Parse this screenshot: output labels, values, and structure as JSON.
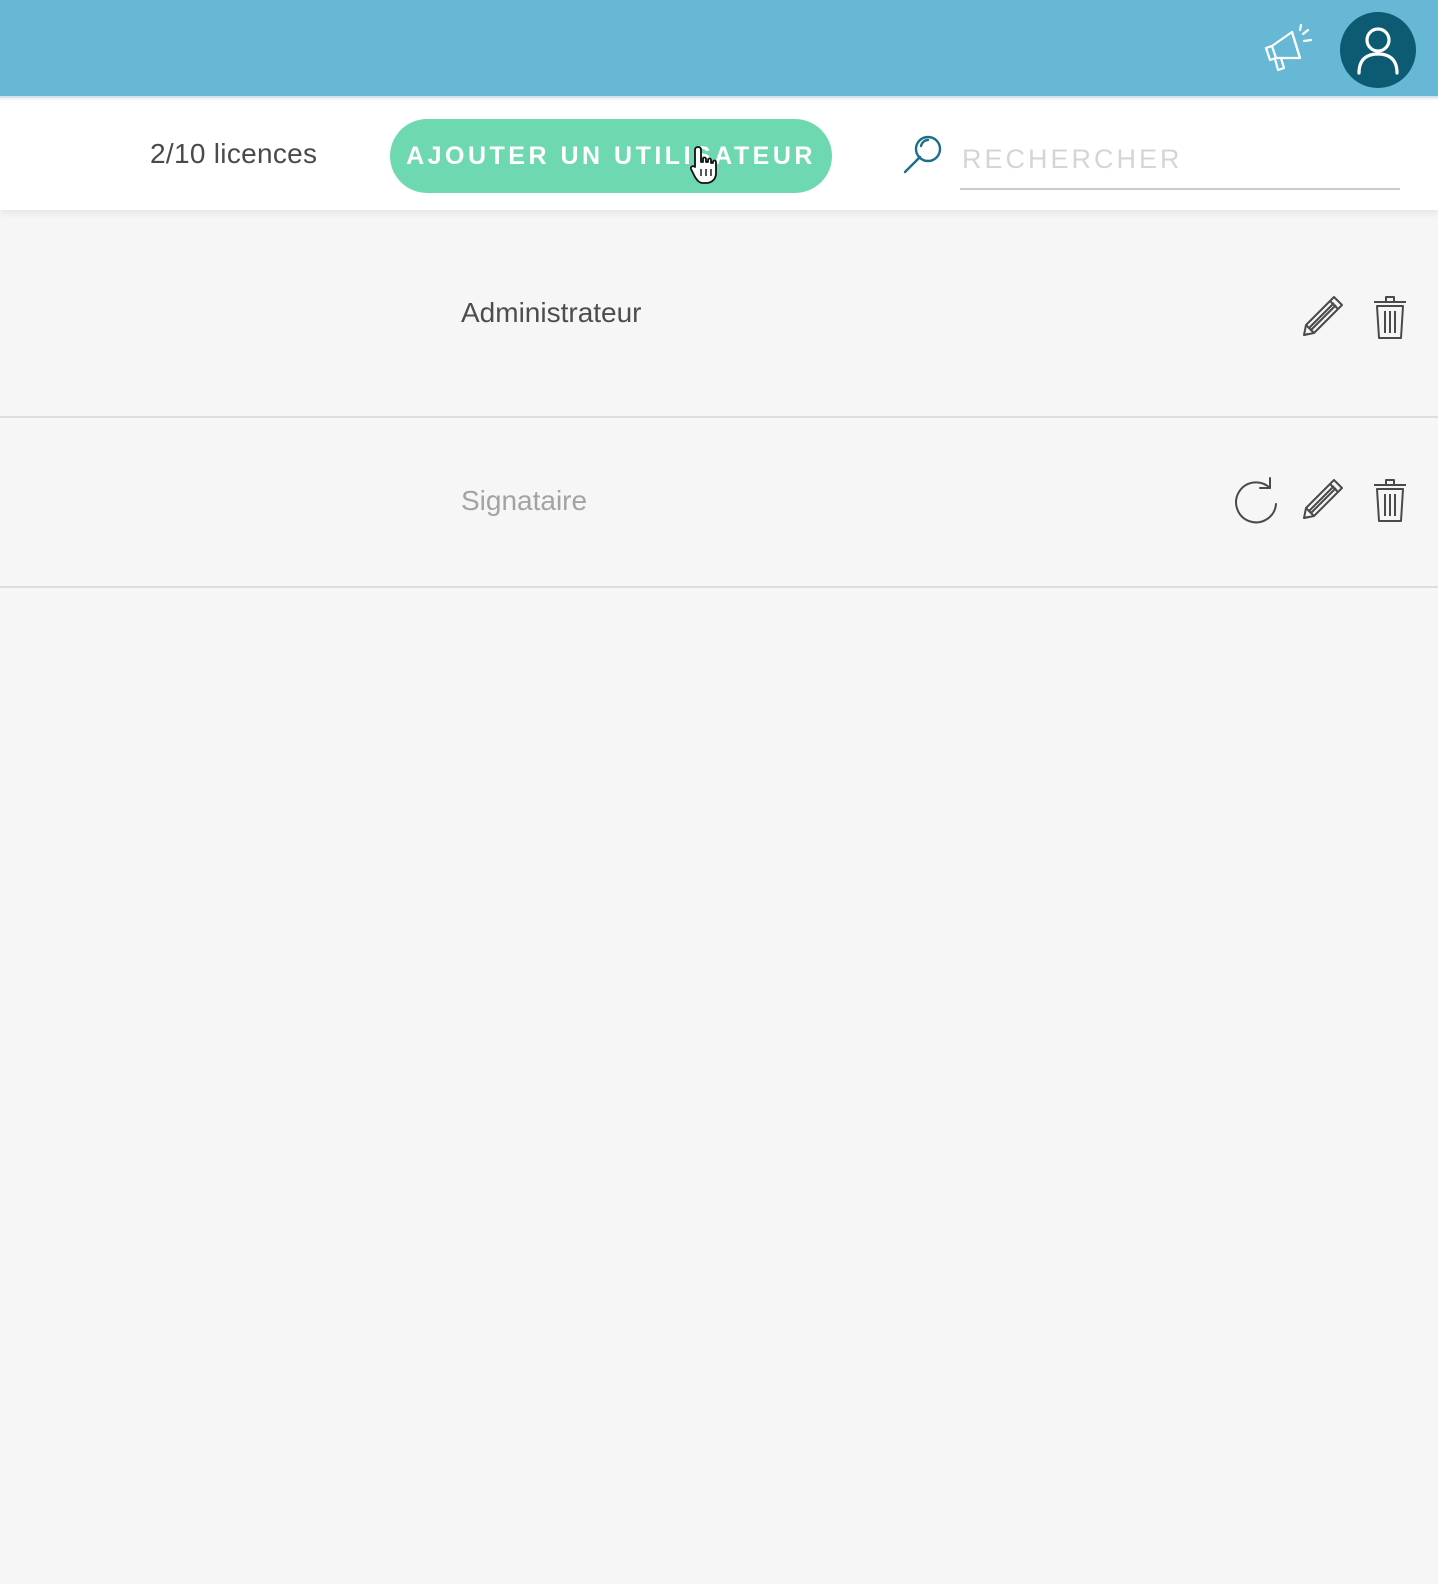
{
  "header": {
    "icons": {
      "announcements": "megaphone-icon",
      "profile": "user-icon"
    },
    "colors": {
      "bar": "#66b8d4",
      "avatar": "#0d5b73"
    }
  },
  "toolbar": {
    "licences_label": "2/10 licences",
    "add_user_label": "AJOUTER UN UTILISATEUR",
    "search_placeholder": "RECHERCHER",
    "colors": {
      "add_button": "#6ed9b0",
      "search_icon": "#1d6e88"
    }
  },
  "users": [
    {
      "role": "Administrateur",
      "actions": [
        "edit",
        "delete"
      ]
    },
    {
      "role": "Signataire",
      "actions": [
        "resend",
        "edit",
        "delete"
      ]
    }
  ]
}
